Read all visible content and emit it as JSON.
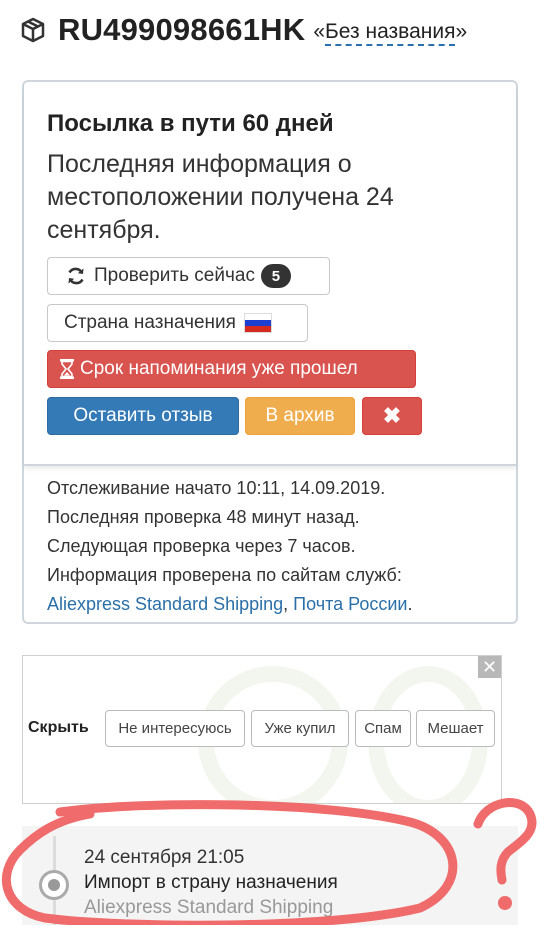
{
  "header": {
    "icon": "package-icon",
    "tracking_number": "RU499098661HK",
    "name_prefix": "«",
    "name_label": "Без названия",
    "name_suffix": "»"
  },
  "status": {
    "days_title": "Посылка в пути 60 дней",
    "last_info": "Последняя информация о местоположении получена 24 сентября."
  },
  "buttons": {
    "check_now": "Проверить сейчас",
    "check_badge": "5",
    "destination": "Страна назначения",
    "reminder_expired": "Срок напоминания уже прошел",
    "review": "Оставить отзыв",
    "archive": "В архив",
    "delete_symbol": "✖"
  },
  "info": {
    "started": "Отслеживание начато 10:11, 14.09.2019.",
    "last_check": "Последняя проверка 48 минут назад.",
    "next_check": "Следующая проверка через 7 часов.",
    "checked_by": "Информация проверена по сайтам служб:",
    "service_1": "Aliexpress Standard Shipping",
    "separator": ", ",
    "service_2": "Почта России",
    "end": "."
  },
  "ad": {
    "hide_label": "Скрыть",
    "close_symbol": "✕",
    "options": [
      "Не интересуюсь",
      "Уже купил",
      "Спам",
      "Мешает"
    ]
  },
  "timeline": {
    "events": [
      {
        "date": "24 сентября 21:05",
        "event": "Импорт в страну назначения",
        "service": "Aliexpress Standard Shipping"
      }
    ]
  },
  "colors": {
    "primary": "#337ab7",
    "warning": "#f0ad4e",
    "danger": "#d9534f",
    "link": "#2a6fa8",
    "annotation": "#f06b6b"
  }
}
